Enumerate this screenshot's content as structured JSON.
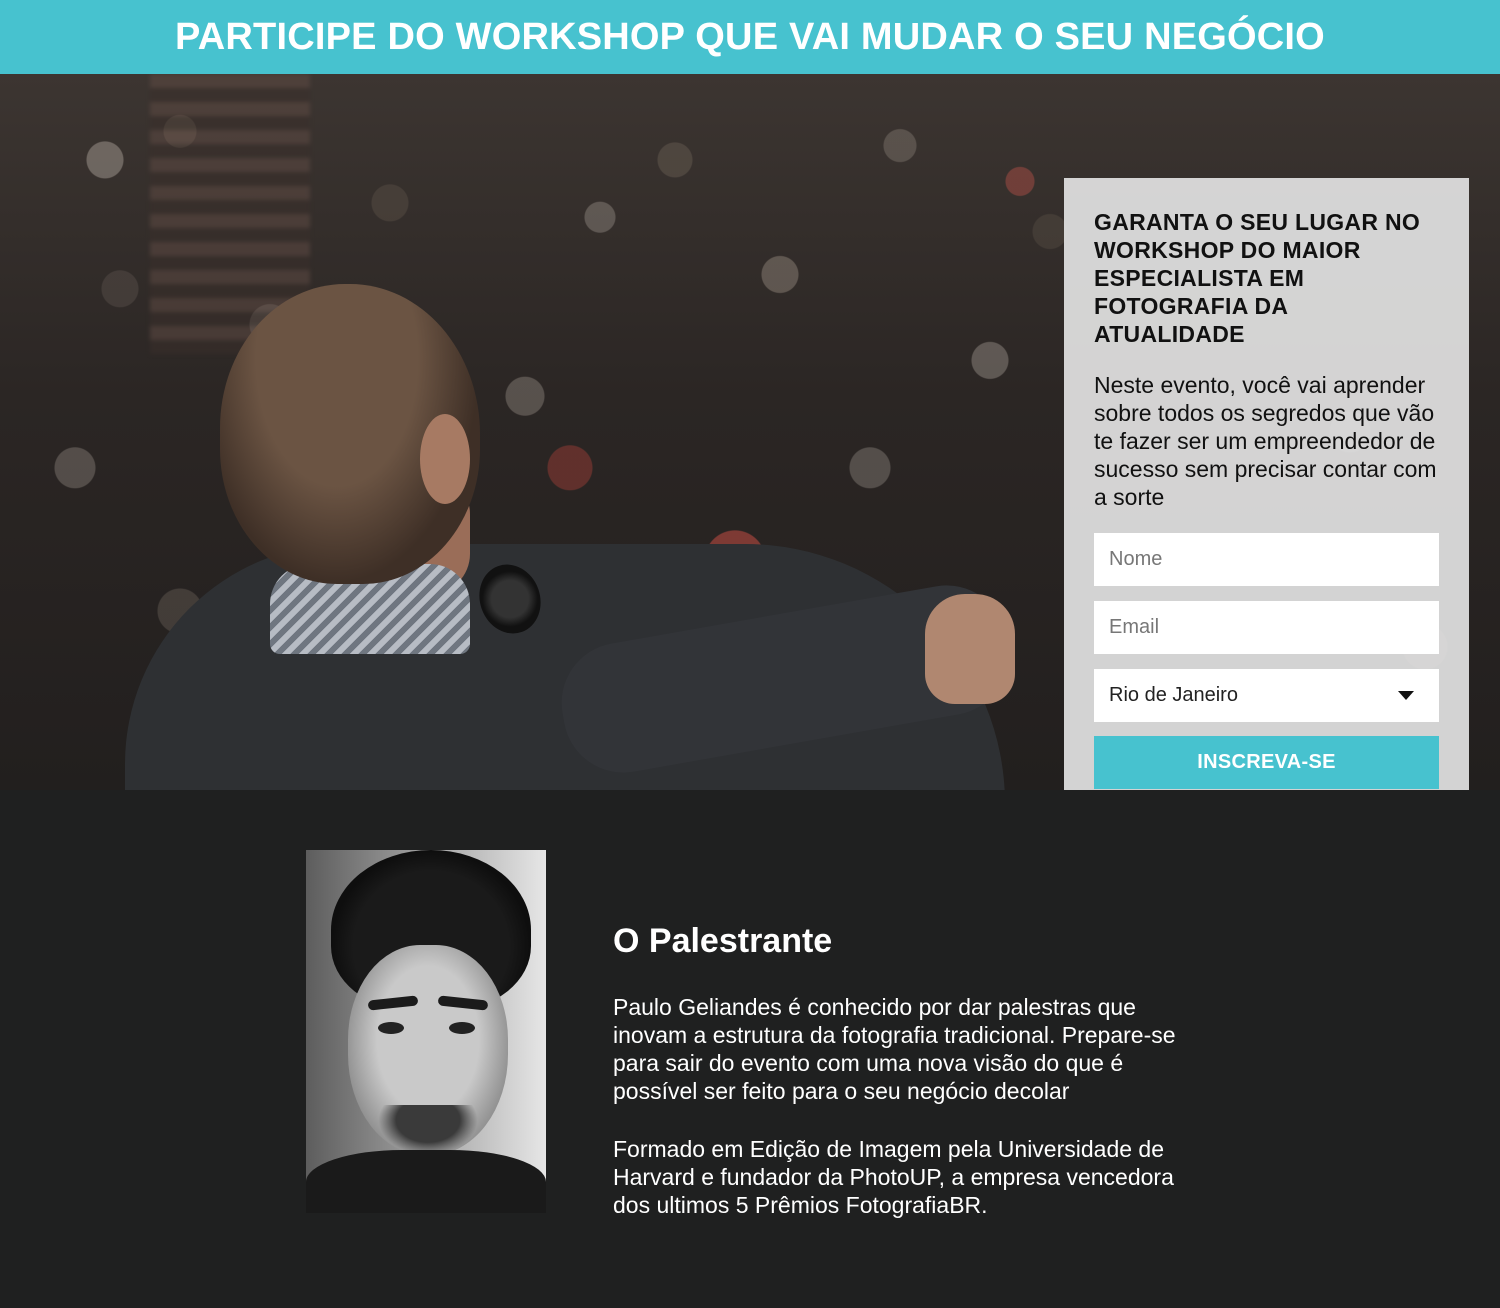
{
  "header": {
    "title": "PARTICIPE DO WORKSHOP QUE VAI MUDAR O SEU NEGÓCIO",
    "bg_color": "#47c2cf"
  },
  "hero": {
    "image": "speaker-with-microphone-audience-photo"
  },
  "form": {
    "title": "GARANTA O SEU LUGAR NO WORKSHOP DO MAIOR ESPECIALISTA EM FOTOGRAFIA DA ATUALIDADE",
    "description": "Neste evento, você vai aprender sobre todos os segredos que vão te fazer ser um empreendedor de sucesso sem precisar contar com a sorte",
    "name_placeholder": "Nome",
    "email_placeholder": "Email",
    "city_selected": "Rio de Janeiro",
    "submit_label": "INSCREVA-SE",
    "accent_color": "#47c2cf"
  },
  "speaker": {
    "photo": "speaker-portrait-bw",
    "title": "O Palestrante",
    "bio_1": "Paulo Geliandes é conhecido por dar palestras que inovam a estrutura da fotografia tradicional. Prepare-se para sair do evento com uma nova visão do que é possível ser feito para o seu negócio decolar",
    "bio_2": "Formado em Edição de Imagem pela Universidade de Harvard e fundador da PhotoUP, a empresa vencedora dos ultimos 5 Prêmios FotografiaBR."
  }
}
